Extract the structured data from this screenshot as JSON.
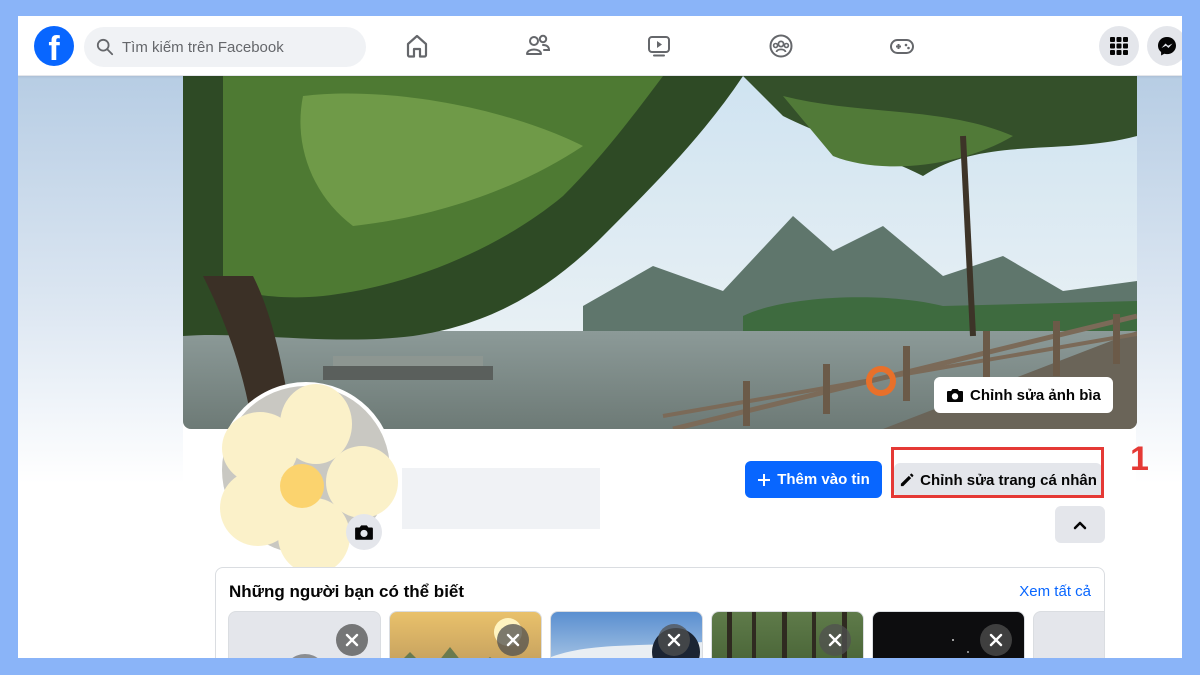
{
  "header": {
    "logo": "f",
    "search_placeholder": "Tìm kiếm trên Facebook",
    "nav_tabs": [
      {
        "name": "home-icon"
      },
      {
        "name": "friends-icon"
      },
      {
        "name": "watch-icon"
      },
      {
        "name": "groups-icon"
      },
      {
        "name": "gaming-icon"
      }
    ],
    "right_icons": [
      {
        "name": "menu-grid-icon"
      },
      {
        "name": "messenger-icon"
      }
    ]
  },
  "profile": {
    "edit_cover_label": "Chỉnh sửa ảnh bìa",
    "add_story_label": "Thêm vào tin",
    "edit_profile_label": "Chỉnh sửa trang cá nhân"
  },
  "annotation": {
    "step_number": "1",
    "highlight_color": "#e53935"
  },
  "suggestions": {
    "title": "Những người bạn có thể biết",
    "see_all_label": "Xem tất cả"
  },
  "colors": {
    "brand_blue": "#0866ff",
    "page_border": "#8ab4f8"
  }
}
